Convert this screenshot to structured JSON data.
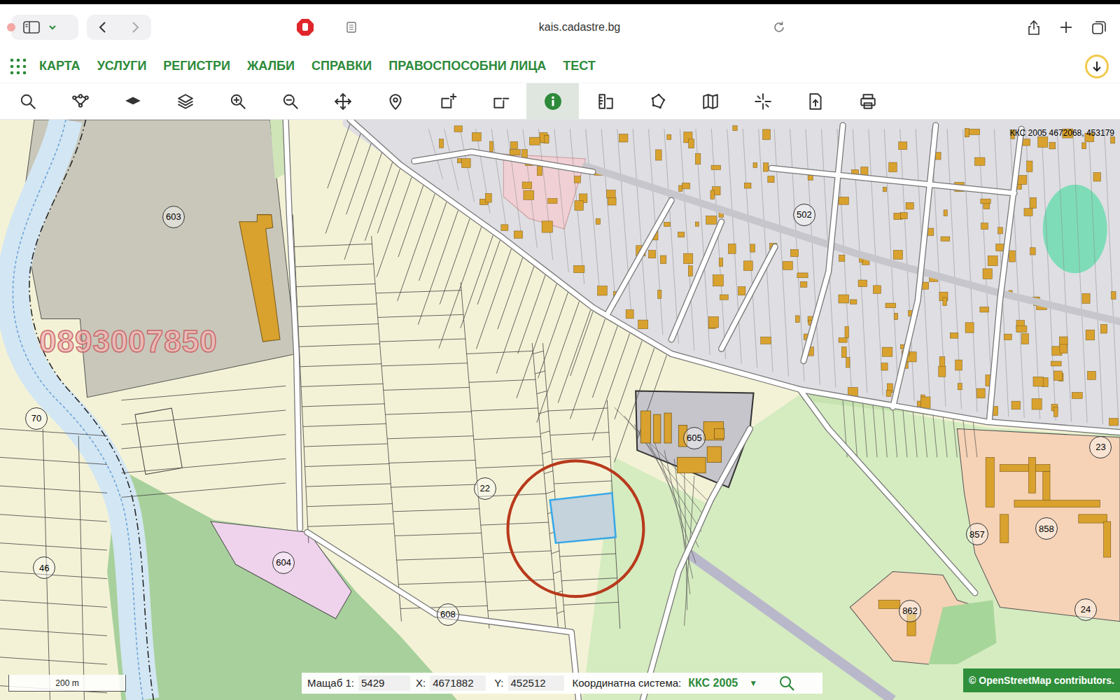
{
  "browser": {
    "url": "kais.cadastre.bg"
  },
  "menu": [
    {
      "label": "КАРТА"
    },
    {
      "label": "УСЛУГИ"
    },
    {
      "label": "РЕГИСТРИ"
    },
    {
      "label": "ЖАЛБИ"
    },
    {
      "label": "СПРАВКИ"
    },
    {
      "label": "ПРАВОСПОСОБНИ ЛИЦА"
    },
    {
      "label": "ТЕСТ"
    }
  ],
  "toolbar": [
    {
      "selected": false
    },
    {
      "selected": false
    },
    {
      "selected": false
    },
    {
      "selected": false
    },
    {
      "selected": false
    },
    {
      "selected": false
    },
    {
      "selected": false
    },
    {
      "selected": false
    },
    {
      "selected": false
    },
    {
      "selected": false
    },
    {
      "selected": true
    },
    {
      "selected": false
    },
    {
      "selected": false
    },
    {
      "selected": false
    },
    {
      "selected": false
    },
    {
      "selected": false
    },
    {
      "selected": false
    }
  ],
  "map": {
    "coordinate_label": "ККС 2005 4672068, 453179",
    "watermark": "0893007850",
    "labels": [
      "603",
      "70",
      "46",
      "604",
      "608",
      "22",
      "605",
      "502",
      "23",
      "857",
      "858",
      "862",
      "24"
    ],
    "scale_bar": "200 m",
    "attribution": "© OpenStreetMap contributors."
  },
  "status_bar": {
    "scale_label": "Мащаб 1:",
    "scale": "5429",
    "x_label": "X:",
    "x": "4671882",
    "y_label": "Y:",
    "y": "452512",
    "crs_label": "Координатна система:",
    "crs": "ККС 2005",
    "crs_dropdown": "▼"
  }
}
